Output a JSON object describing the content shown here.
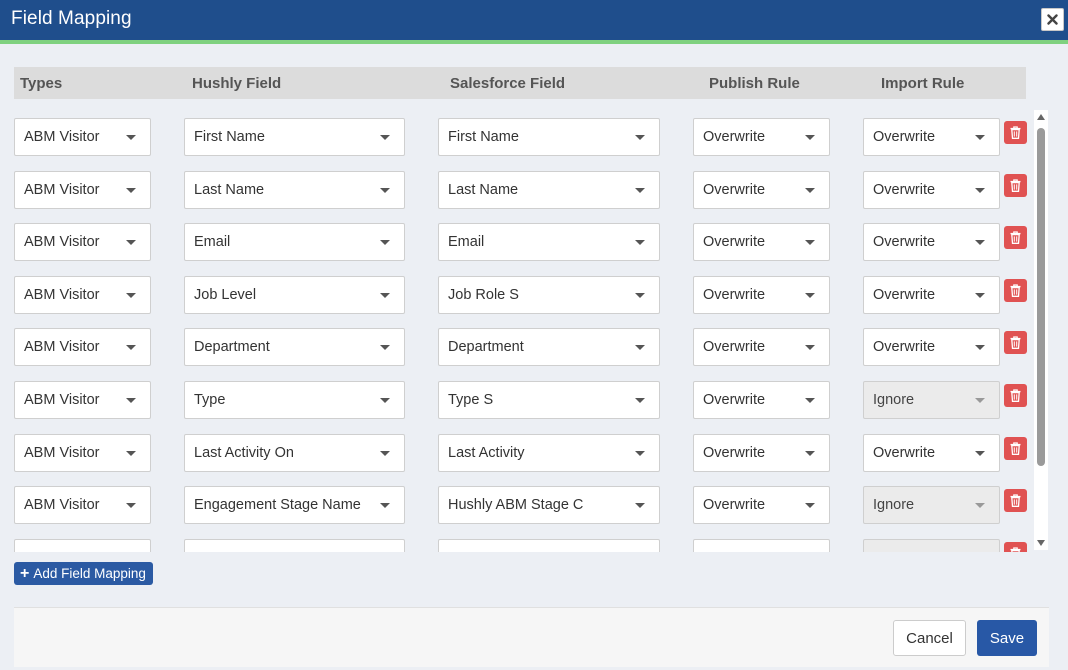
{
  "dialog": {
    "title": "Field Mapping",
    "close_icon": "close-icon"
  },
  "columns": {
    "types": "Types",
    "hushly": "Hushly Field",
    "salesforce": "Salesforce Field",
    "publish": "Publish Rule",
    "import": "Import Rule"
  },
  "rows": [
    {
      "type": "ABM Visitor",
      "hushly": "First Name",
      "salesforce": "First Name",
      "publish": "Overwrite",
      "import": "Overwrite",
      "import_disabled": false
    },
    {
      "type": "ABM Visitor",
      "hushly": "Last Name",
      "salesforce": "Last Name",
      "publish": "Overwrite",
      "import": "Overwrite",
      "import_disabled": false
    },
    {
      "type": "ABM Visitor",
      "hushly": "Email",
      "salesforce": "Email",
      "publish": "Overwrite",
      "import": "Overwrite",
      "import_disabled": false
    },
    {
      "type": "ABM Visitor",
      "hushly": "Job Level",
      "salesforce": "Job Role S",
      "publish": "Overwrite",
      "import": "Overwrite",
      "import_disabled": false
    },
    {
      "type": "ABM Visitor",
      "hushly": "Department",
      "salesforce": "Department",
      "publish": "Overwrite",
      "import": "Overwrite",
      "import_disabled": false
    },
    {
      "type": "ABM Visitor",
      "hushly": "Type",
      "salesforce": "Type S",
      "publish": "Overwrite",
      "import": "Ignore",
      "import_disabled": true
    },
    {
      "type": "ABM Visitor",
      "hushly": "Last Activity On",
      "salesforce": "Last Activity",
      "publish": "Overwrite",
      "import": "Overwrite",
      "import_disabled": false
    },
    {
      "type": "ABM Visitor",
      "hushly": "Engagement Stage Name",
      "salesforce": "Hushly ABM Stage C",
      "publish": "Overwrite",
      "import": "Ignore",
      "import_disabled": true
    },
    {
      "type": "",
      "hushly": "",
      "salesforce": "",
      "publish": "",
      "import": "",
      "import_disabled": true
    }
  ],
  "icons": {
    "row_delete": "trash-icon",
    "dropdown": "chevron-down-icon",
    "add": "plus-icon"
  },
  "actions": {
    "add_label": "Add Field Mapping",
    "cancel_label": "Cancel",
    "save_label": "Save"
  },
  "colors": {
    "header_bar": "#1f4e8c",
    "accent_line": "#7fd17f",
    "primary_button": "#2858a6",
    "delete_button": "#e05252"
  }
}
